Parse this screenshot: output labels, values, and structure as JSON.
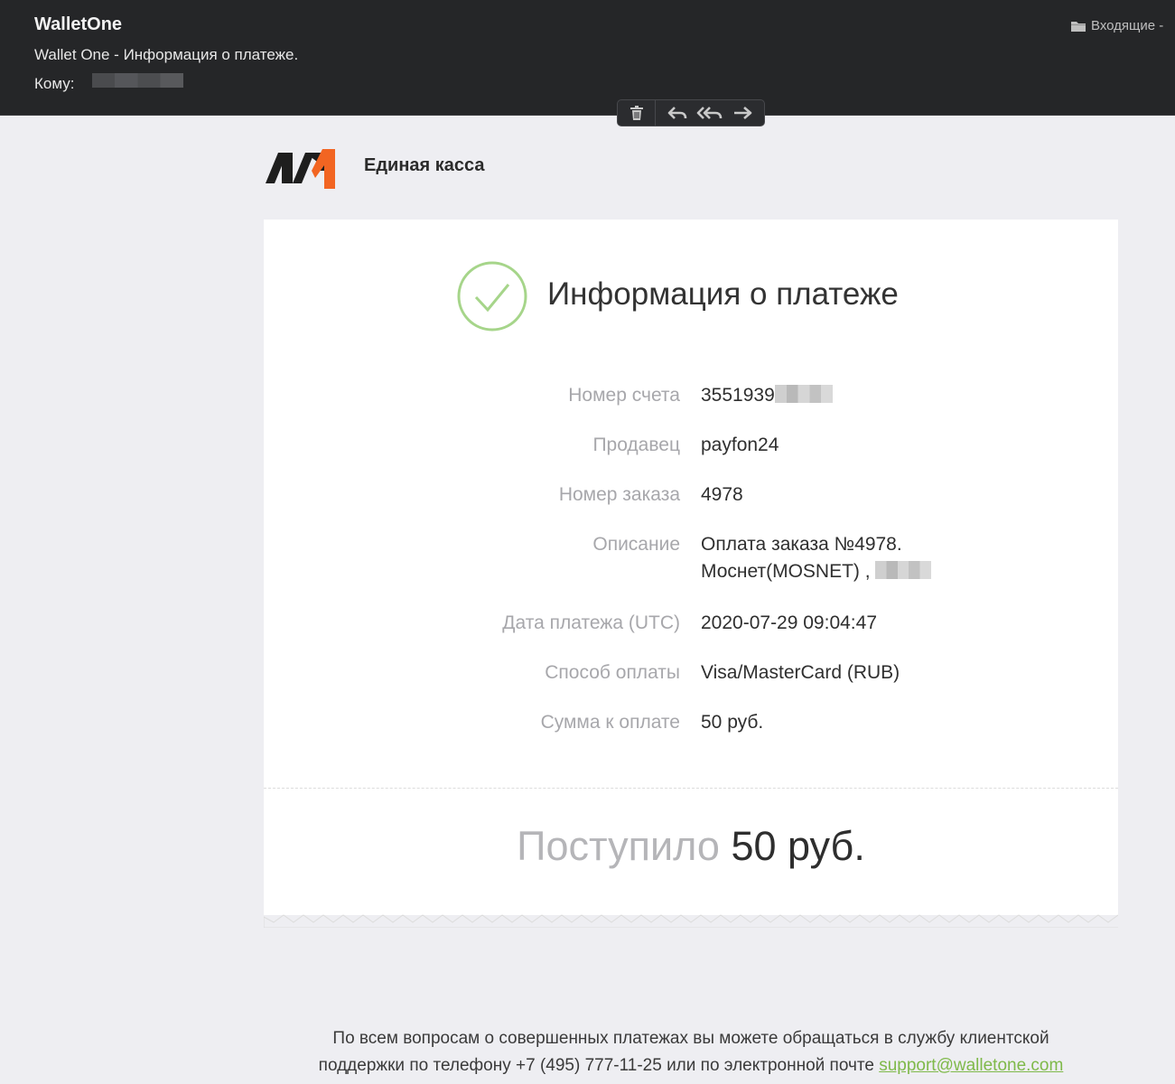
{
  "mail": {
    "sender": "WalletOne",
    "subject": "Wallet One - Информация о платеже.",
    "to_label": "Кому:",
    "folder": "Входящие -"
  },
  "toolbar": {
    "icons": [
      "trash-icon",
      "reply-icon",
      "reply-all-icon",
      "forward-icon"
    ]
  },
  "brand": {
    "name": "Единая касса",
    "logo_colors": {
      "dark": "#1e1e1e",
      "accent": "#f26522"
    }
  },
  "payment": {
    "title": "Информация о платеже",
    "rows": [
      {
        "label": "Номер счета",
        "value": "3551939"
      },
      {
        "label": "Продавец",
        "value": "payfon24"
      },
      {
        "label": "Номер заказа",
        "value": "4978"
      },
      {
        "label": "Описание",
        "value": "Оплата заказа №4978.",
        "value_line2": "Моснет(MOSNET) , "
      },
      {
        "label": "Дата платежа (UTC)",
        "value": "2020-07-29 09:04:47"
      },
      {
        "label": "Способ оплаты",
        "value": "Visa/MasterCard (RUB)"
      },
      {
        "label": "Сумма к оплате",
        "value": "50 руб."
      }
    ],
    "received_label": "Поступило",
    "received_amount": "50 руб."
  },
  "footer": {
    "text_line1": "По всем вопросам о совершенных платежах вы можете обращаться в службу клиентской",
    "text_line2": "поддержки по телефону +7 (495) 777-11-25 или по электронной почте",
    "email": "support@walletone.com"
  },
  "colors": {
    "header_bg": "#252628",
    "page_bg": "#eeeef2",
    "check_green": "#a6d58a",
    "link_green": "#7fb94a"
  }
}
